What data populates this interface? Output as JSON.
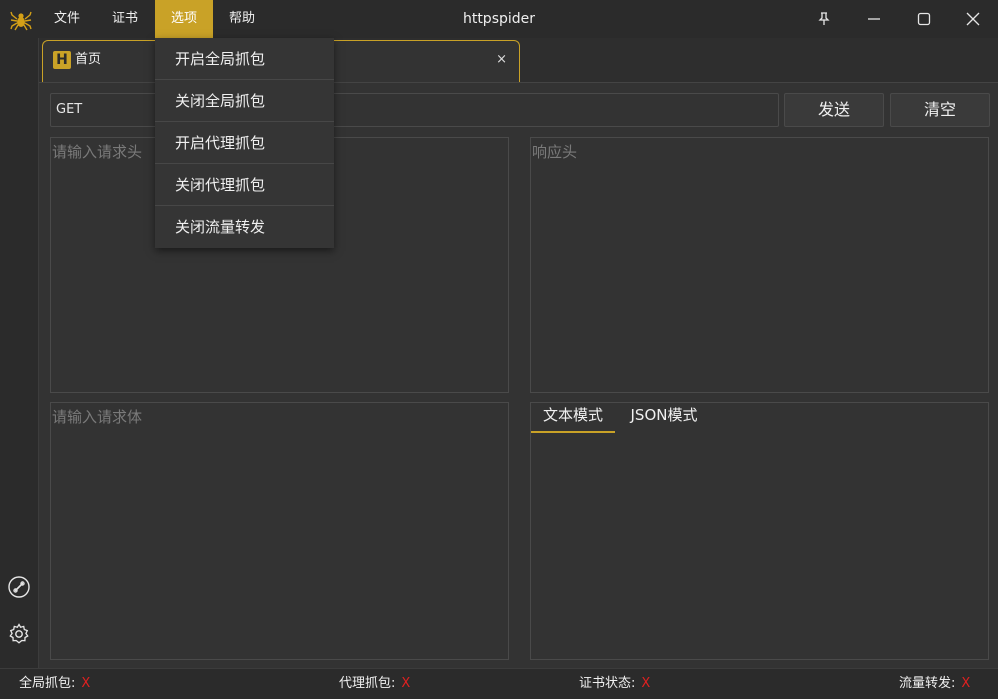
{
  "window": {
    "title": "httpspider"
  },
  "menubar": {
    "items": [
      "文件",
      "证书",
      "选项",
      "帮助"
    ]
  },
  "tab": {
    "label": "首页",
    "logo_letter": "H",
    "close": "×"
  },
  "request": {
    "method": "GET",
    "send_label": "发送",
    "clear_label": "清空"
  },
  "panels": {
    "request_headers_placeholder": "请输入请求头",
    "response_headers_placeholder": "响应头",
    "request_body_placeholder": "请输入请求体"
  },
  "response_tabs": [
    "文本模式",
    "JSON模式"
  ],
  "dropdown": {
    "items": [
      "开启全局抓包",
      "关闭全局抓包",
      "开启代理抓包",
      "关闭代理抓包",
      "关闭流量转发"
    ]
  },
  "status": {
    "global_capture_label": "全局抓包:",
    "global_capture_value": "X",
    "proxy_capture_label": "代理抓包:",
    "proxy_capture_value": "X",
    "cert_status_label": "证书状态:",
    "cert_status_value": "X",
    "traffic_forward_label": "流量转发:",
    "traffic_forward_value": "X"
  },
  "colors": {
    "accent": "#c9a227",
    "status_x": "#e02020",
    "background": "#2b2b2b"
  }
}
